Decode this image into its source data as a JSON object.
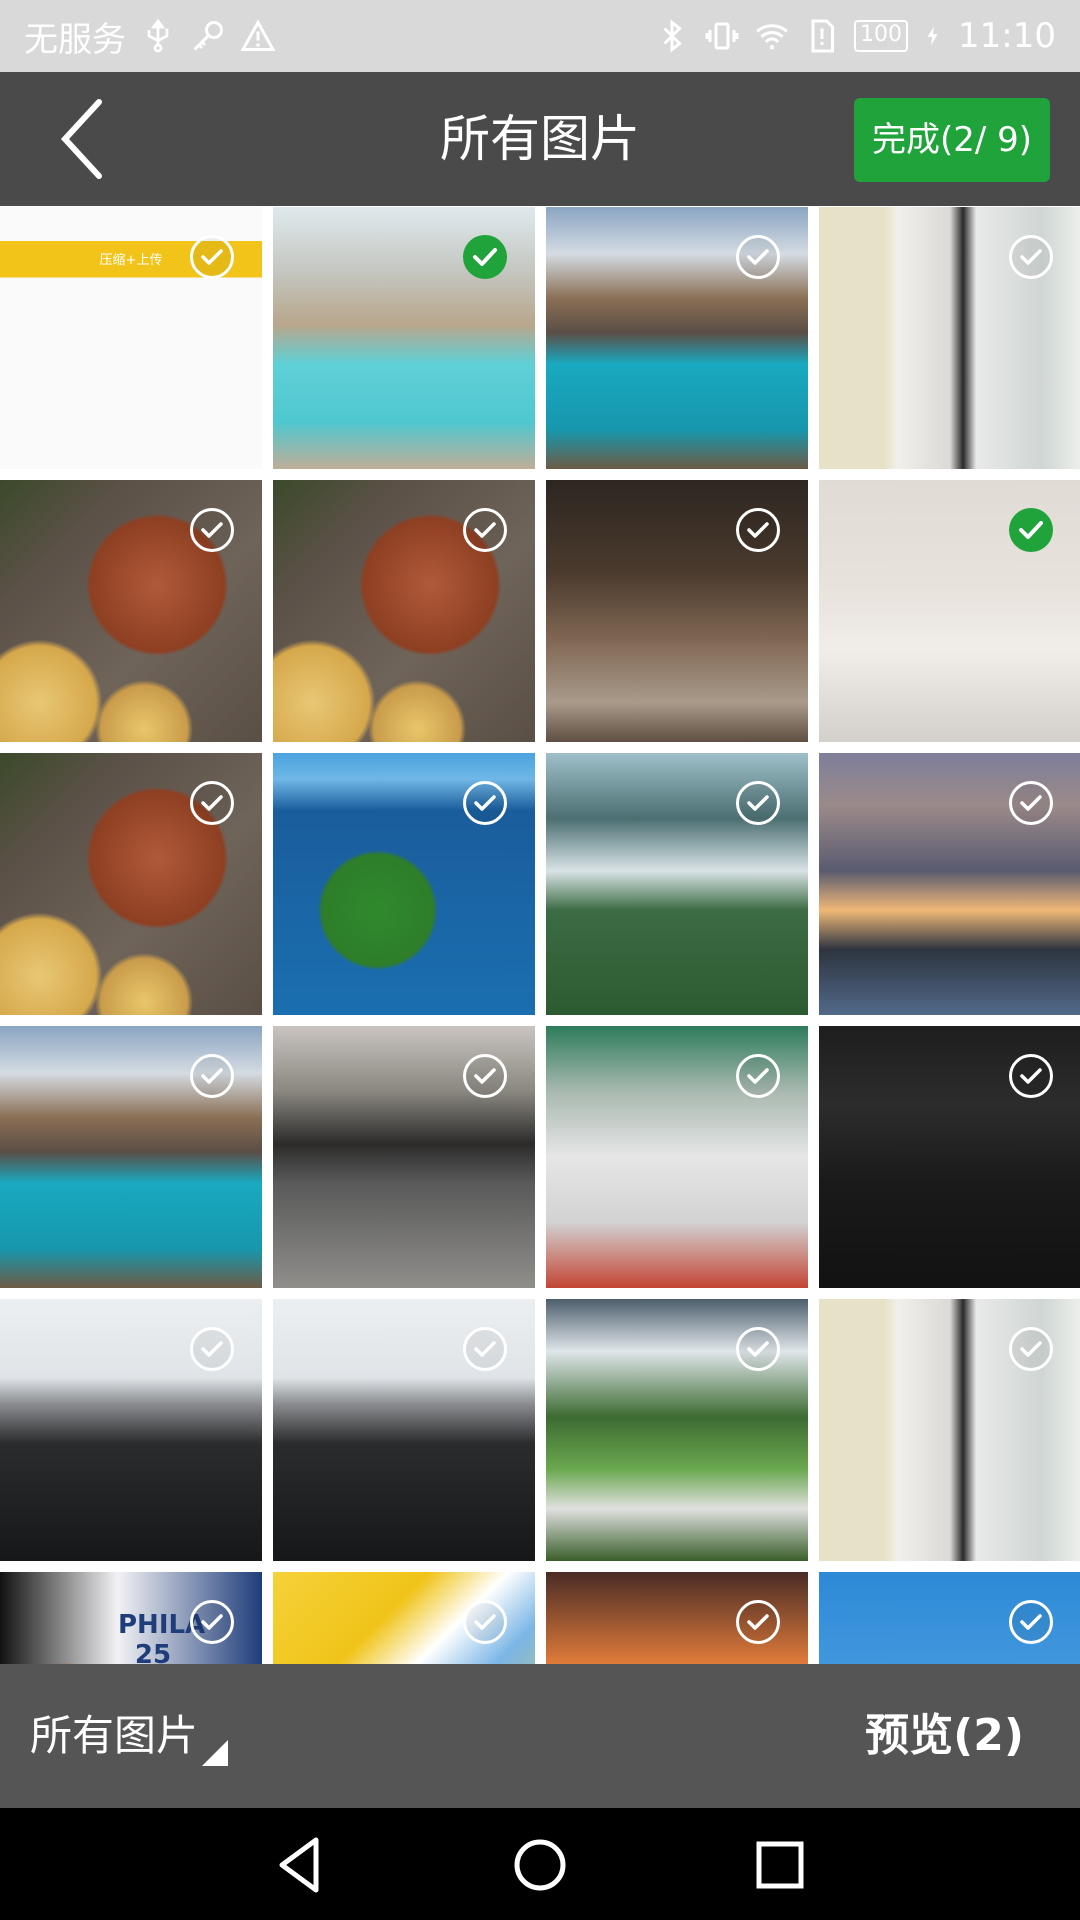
{
  "status_bar": {
    "carrier": "无服务",
    "battery": "100",
    "time": "11:10"
  },
  "header": {
    "title": "所有图片",
    "done_label": "完成(2/ 9)"
  },
  "photo_grid": {
    "items": [
      {
        "thumb": "app-screenshot",
        "caption": "压缩+上传",
        "selected": false
      },
      {
        "thumb": "mountain-lake-light",
        "selected": true
      },
      {
        "thumb": "mountain-lake",
        "selected": false
      },
      {
        "thumb": "woman-dress",
        "selected": false
      },
      {
        "thumb": "teapot",
        "selected": false
      },
      {
        "thumb": "teapot",
        "selected": false
      },
      {
        "thumb": "carving-hand",
        "selected": false
      },
      {
        "thumb": "carving-hand-light",
        "selected": true
      },
      {
        "thumb": "teapot",
        "selected": false
      },
      {
        "thumb": "island-lake",
        "selected": false
      },
      {
        "thumb": "misty-mountains",
        "selected": false
      },
      {
        "thumb": "city-harbor",
        "selected": false
      },
      {
        "thumb": "mountain-lake",
        "selected": false
      },
      {
        "thumb": "woman-walking",
        "selected": false
      },
      {
        "thumb": "trophy-player",
        "selected": false
      },
      {
        "thumb": "dark-room",
        "selected": false
      },
      {
        "thumb": "laptop-code",
        "selected": false
      },
      {
        "thumb": "laptop-code",
        "selected": false
      },
      {
        "thumb": "valley-village",
        "selected": false
      },
      {
        "thumb": "woman-dress",
        "selected": false
      },
      {
        "thumb": "basketball-player",
        "jersey_text": "PHILA 25",
        "selected": false
      },
      {
        "thumb": "yellow-architecture",
        "selected": false
      },
      {
        "thumb": "sunset-clouds",
        "selected": false
      },
      {
        "thumb": "snow-peak",
        "selected": false
      }
    ]
  },
  "bottom_bar": {
    "album_label": "所有图片",
    "preview_label": "预览(2)"
  },
  "colors": {
    "status_bar_bg": "#d9d9d9",
    "top_bar_bg": "#4a4a4a",
    "accent_green": "#1fa33a",
    "bottom_bar_bg": "#555555",
    "nav_bar_bg": "#000000"
  },
  "icons": {
    "back": "chevron-left-icon",
    "check": "check-circle-icon",
    "nav_back": "nav-back-icon",
    "nav_home": "nav-home-icon",
    "nav_recents": "nav-recents-icon"
  }
}
